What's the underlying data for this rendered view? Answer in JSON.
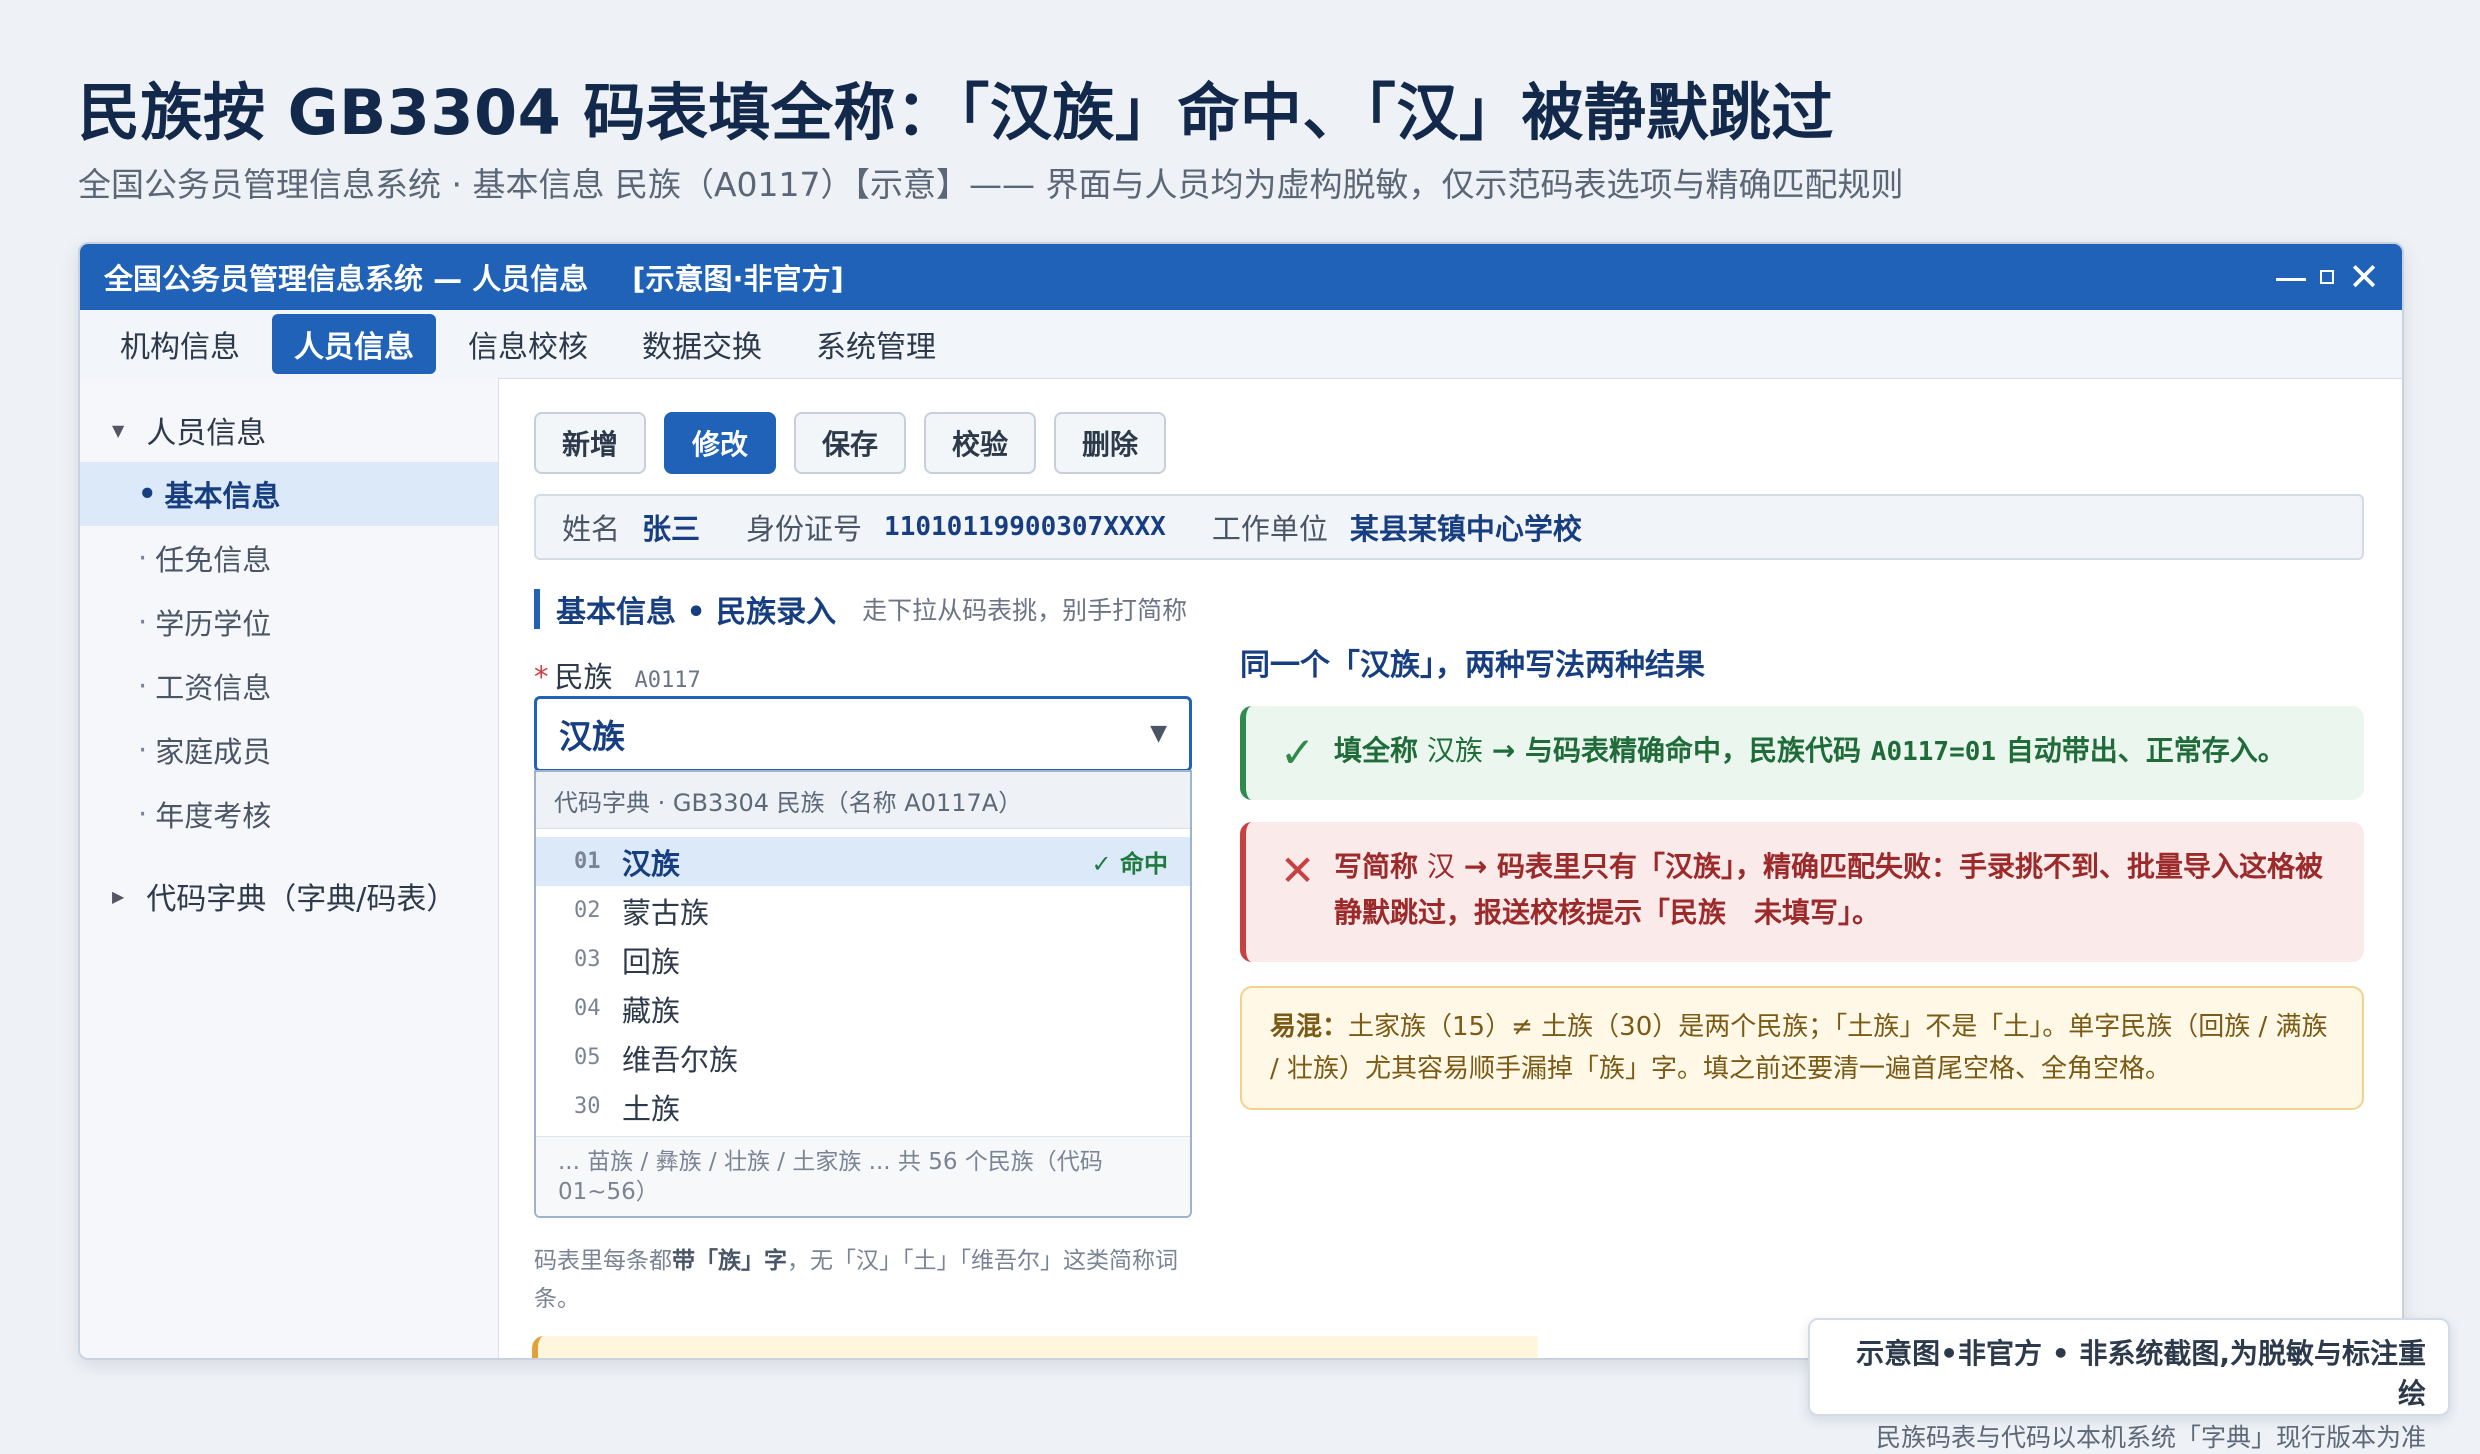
{
  "hero": {
    "title": "民族按 GB3304 码表填全称：「汉族」命中、「汉」被静默跳过",
    "subtitle": "全国公务员管理信息系统 · 基本信息 民族（A0117）【示意】—— 界面与人员均为虚构脱敏，仅示范码表选项与精确匹配规则"
  },
  "window": {
    "title": "全国公务员管理信息系统 — 人员信息",
    "tag": "[示意图·非官方]",
    "controls": {
      "minimize": "—",
      "maximize": "□",
      "close": "✕"
    }
  },
  "menu": [
    {
      "label": "机构信息",
      "active": false
    },
    {
      "label": "人员信息",
      "active": true
    },
    {
      "label": "信息校核",
      "active": false
    },
    {
      "label": "数据交换",
      "active": false
    },
    {
      "label": "系统管理",
      "active": false
    }
  ],
  "sidebar": {
    "group1": {
      "caret": "▼",
      "label": "人员信息"
    },
    "items": [
      {
        "label": "基本信息",
        "active": true
      },
      {
        "label": "任免信息",
        "active": false
      },
      {
        "label": "学历学位",
        "active": false
      },
      {
        "label": "工资信息",
        "active": false
      },
      {
        "label": "家庭成员",
        "active": false
      },
      {
        "label": "年度考核",
        "active": false
      }
    ],
    "group2": {
      "caret": "▶",
      "label": "代码字典（字典/码表）"
    }
  },
  "toolbar": {
    "buttons": [
      "新增",
      "修改",
      "保存",
      "校验",
      "删除"
    ],
    "primary_index": 1
  },
  "person": {
    "name_label": "姓名",
    "name": "张三",
    "id_label": "身份证号",
    "id": "11010119900307XXXX",
    "unit_label": "工作单位",
    "unit": "某县某镇中心学校"
  },
  "section": {
    "title": "基本信息 • 民族录入",
    "hint": "走下拉从码表挑，别手打简称"
  },
  "field": {
    "required_mark": "*",
    "label": "民族",
    "code": "A0117",
    "value": "汉族",
    "arrow": "▼"
  },
  "dropdown": {
    "header": "代码字典 · GB3304 民族（名称 A0117A）",
    "options": [
      {
        "code": "01",
        "name": "汉族",
        "selected": true,
        "hit": "✓ 命中"
      },
      {
        "code": "02",
        "name": "蒙古族"
      },
      {
        "code": "03",
        "name": "回族"
      },
      {
        "code": "04",
        "name": "藏族"
      },
      {
        "code": "05",
        "name": "维吾尔族"
      },
      {
        "code": "30",
        "name": "土族"
      }
    ],
    "footer": "... 苗族 / 彝族 / 壮族 / 土家族 ... 共 56 个民族（代码 01~56）"
  },
  "note_under": {
    "pre": "码表里每条都",
    "bold": "带「族」字",
    "post": "，无「汉」「土」「维吾尔」这类简称词条。"
  },
  "right": {
    "title": "同一个「汉族」，两种写法两种结果",
    "ok": {
      "icon": "✓",
      "a": "填全称",
      "b": " 汉族 ",
      "c": "→ 与码表精确命中，民族代码 ",
      "d": "A0117=01",
      "e": " 自动带出、正常存入。"
    },
    "bad": {
      "icon": "✕",
      "a": "写简称",
      "b": " 汉 ",
      "c": "→ 码表里只有「汉族」，精确匹配失败：手录挑不到、批量导入这格被静默跳过，报送校核提示「民族　未填写」。"
    },
    "warn": {
      "bold": "易混：",
      "text": "土家族（15）≠ 土族（30）是两个民族；「土族」不是「土」。单字民族（回族 / 满族 / 壮族）尤其容易顺手漏掉「族」字。填之前还要清一遍首尾空格、全角空格。"
    }
  },
  "stamp": {
    "line1": "示意图•非官方 • 非系统截图,为脱敏与标注重绘",
    "line2": "民族码表与代码以本机系统「字典」现行版本为准"
  }
}
